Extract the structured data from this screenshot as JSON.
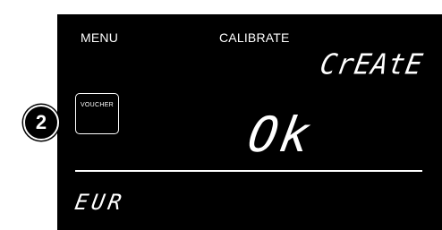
{
  "display": {
    "menu_label": "MENU",
    "mode_label": "CALIBRATE",
    "status_text": "CrEAtE",
    "result_text": "Ok",
    "currency_text": "EUR",
    "voucher_label": "VOUCHER"
  },
  "callout": {
    "step_number": "2"
  },
  "colors": {
    "screen_background": "#000000",
    "screen_foreground": "#ffffff",
    "page_background": "#ffffff"
  }
}
